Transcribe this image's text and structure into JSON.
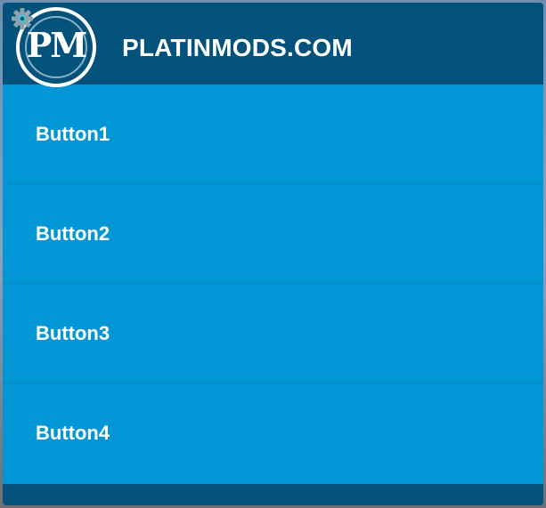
{
  "header": {
    "logo_text": "PM",
    "title": "PLATINMODS.COM",
    "settings_icon": "gear-icon"
  },
  "menu": {
    "buttons": [
      {
        "label": "Button1"
      },
      {
        "label": "Button2"
      },
      {
        "label": "Button3"
      },
      {
        "label": "Button4"
      }
    ]
  },
  "colors": {
    "header_bg": "#02527c",
    "body_bg": "#0296d6",
    "text": "#ffffff"
  }
}
